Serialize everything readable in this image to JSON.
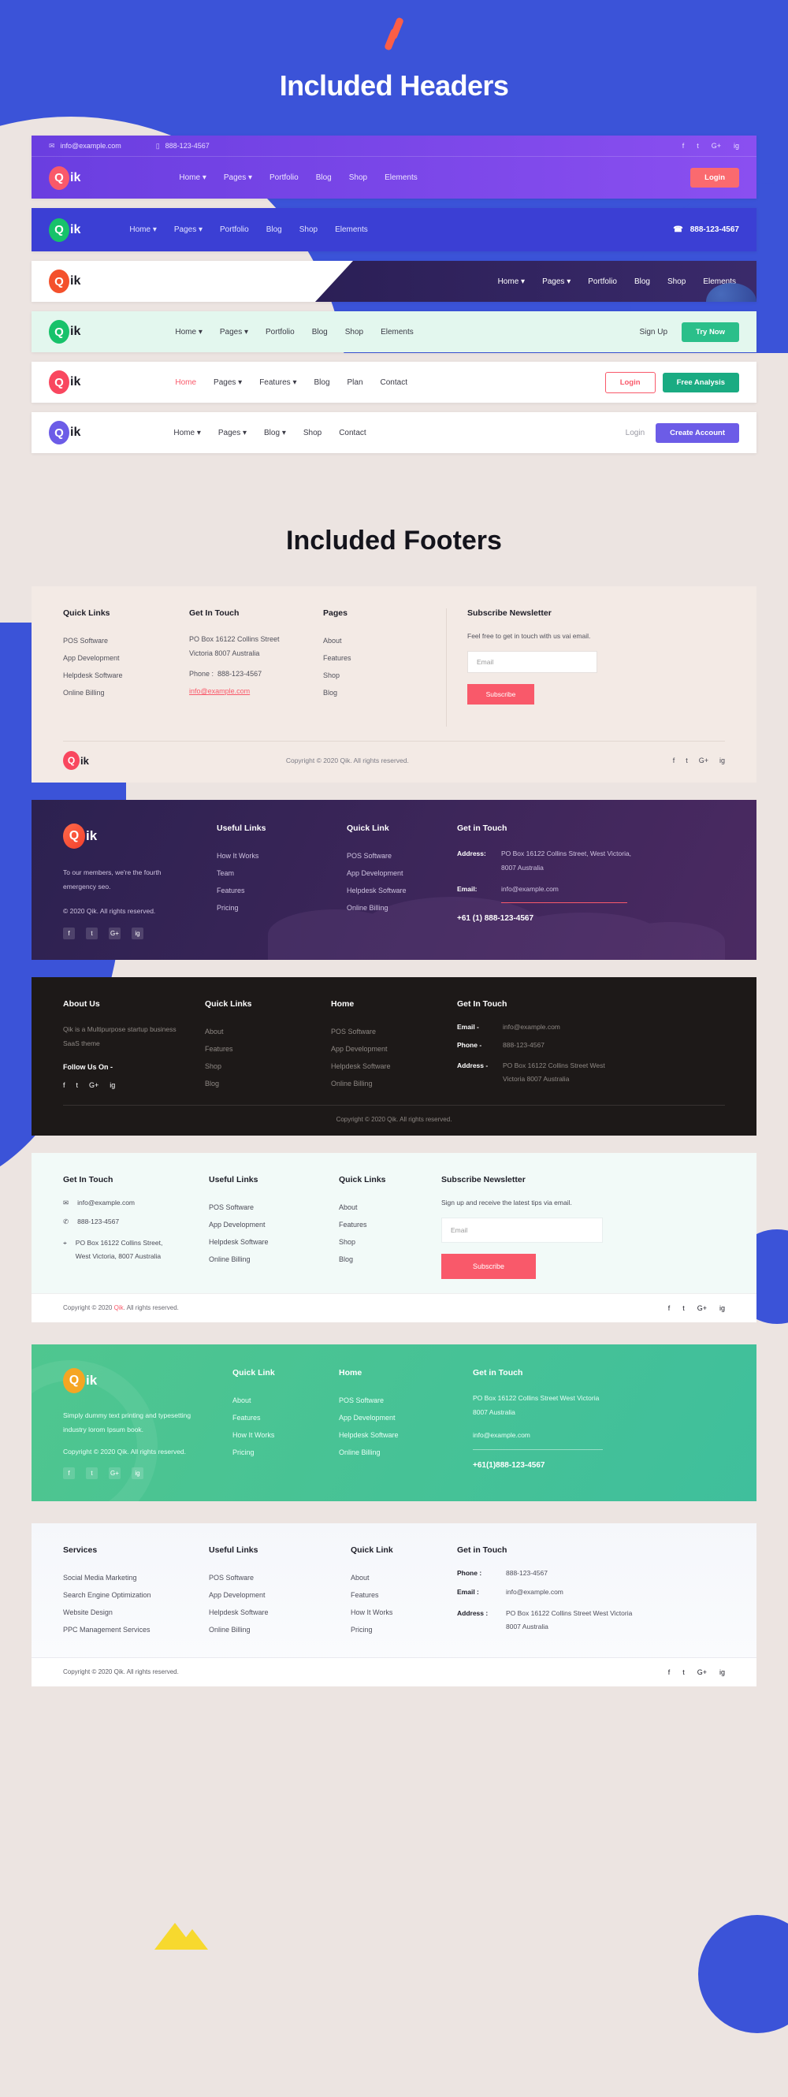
{
  "hero": {
    "logo_icon": "bolt-icon",
    "title": "Included Headers"
  },
  "footers_title": "Included Footers",
  "brand": {
    "mark": "Q",
    "name": "ik",
    "full": "Qik"
  },
  "social": {
    "facebook": "f",
    "twitter": "t",
    "google": "G+",
    "instagram": "ig"
  },
  "headers": [
    {
      "topbar": {
        "email_icon": "envelope-icon",
        "email": "info@example.com",
        "phone_icon": "mobile-icon",
        "phone": "888-123-4567"
      },
      "nav": [
        "Home",
        "Pages",
        "Portfolio",
        "Blog",
        "Shop",
        "Elements"
      ],
      "dropdowns": [
        "Home",
        "Pages"
      ],
      "cta": "Login"
    },
    {
      "nav": [
        "Home",
        "Pages",
        "Portfolio",
        "Blog",
        "Shop",
        "Elements"
      ],
      "phone_icon": "headset-icon",
      "phone": "888-123-4567"
    },
    {
      "nav": [
        "Home",
        "Pages",
        "Portfolio",
        "Blog",
        "Shop",
        "Elements"
      ]
    },
    {
      "nav": [
        "Home",
        "Pages",
        "Portfolio",
        "Blog",
        "Shop",
        "Elements"
      ],
      "signup": "Sign Up",
      "cta": "Try Now"
    },
    {
      "nav": [
        "Home",
        "Pages",
        "Features",
        "Blog",
        "Plan",
        "Contact"
      ],
      "active": "Home",
      "login": "Login",
      "cta": "Free Analysis"
    },
    {
      "nav": [
        "Home",
        "Pages",
        "Blog",
        "Shop",
        "Contact"
      ],
      "login": "Login",
      "cta": "Create Account"
    }
  ],
  "footer1": {
    "col1": {
      "title": "Quick Links",
      "items": [
        "POS Software",
        "App Development",
        "Helpdesk Software",
        "Online Billing"
      ]
    },
    "col2": {
      "title": "Get In Touch",
      "address": "PO Box 16122 Collins Street Victoria 8007 Australia",
      "phone_label": "Phone :",
      "phone": "888-123-4567",
      "email": "info@example.com"
    },
    "col3": {
      "title": "Pages",
      "items": [
        "About",
        "Features",
        "Shop",
        "Blog"
      ]
    },
    "col4": {
      "title": "Subscribe Newsletter",
      "note": "Feel free to get in touch with us vai email.",
      "placeholder": "Email",
      "button": "Subscribe"
    },
    "copyright": "Copyright © 2020 Qik. All rights reserved."
  },
  "footer2": {
    "tagline": "To our members, we're the fourth emergency seo.",
    "copyright": "© 2020 Qik. All rights reserved.",
    "col1": {
      "title": "Useful Links",
      "items": [
        "How It Works",
        "Team",
        "Features",
        "Pricing"
      ]
    },
    "col2": {
      "title": "Quick Link",
      "items": [
        "POS Software",
        "App Development",
        "Helpdesk Software",
        "Online Billing"
      ]
    },
    "col3": {
      "title": "Get in Touch",
      "address_label": "Address:",
      "address": "PO Box 16122 Collins Street, West Victoria, 8007 Australia",
      "email_label": "Email:",
      "email": "info@example.com",
      "phone": "+61 (1) 888-123-4567"
    }
  },
  "footer3": {
    "col1": {
      "title": "About Us",
      "desc": "Qik is a Multipurpose startup business SaaS theme",
      "follow": "Follow Us On -"
    },
    "col2": {
      "title": "Quick Links",
      "items": [
        "About",
        "Features",
        "Shop",
        "Blog"
      ]
    },
    "col3": {
      "title": "Home",
      "items": [
        "POS Software",
        "App Development",
        "Helpdesk Software",
        "Online Billing"
      ]
    },
    "col4": {
      "title": "Get In Touch",
      "email_label": "Email -",
      "email": "info@example.com",
      "phone_label": "Phone -",
      "phone": "888-123-4567",
      "address_label": "Address -",
      "address": "PO Box 16122 Collins Street West Victoria 8007 Australia"
    },
    "copyright": "Copyright © 2020 Qik. All rights reserved."
  },
  "footer4": {
    "col1": {
      "title": "Get In Touch",
      "email": "info@example.com",
      "phone": "888-123-4567",
      "address": "PO Box 16122 Collins Street, West Victoria, 8007 Australia"
    },
    "col2": {
      "title": "Useful Links",
      "items": [
        "POS Software",
        "App Development",
        "Helpdesk Software",
        "Online Billing"
      ]
    },
    "col3": {
      "title": "Quick Links",
      "items": [
        "About",
        "Features",
        "Shop",
        "Blog"
      ]
    },
    "col4": {
      "title": "Subscribe Newsletter",
      "note": "Sign up and receive the latest tips via email.",
      "placeholder": "Email",
      "button": "Subscribe"
    },
    "copyright_pre": "Copyright © 2020 ",
    "copyright_brand": "Qik",
    "copyright_post": ". All rights reserved."
  },
  "footer5": {
    "tagline": "Simply dummy text printing and typesetting industry lorom Ipsum book.",
    "copyright": "Copyright © 2020 Qik. All rights reserved.",
    "col1": {
      "title": "Quick Link",
      "items": [
        "About",
        "Features",
        "How It Works",
        "Pricing"
      ]
    },
    "col2": {
      "title": "Home",
      "items": [
        "POS Software",
        "App Development",
        "Helpdesk Software",
        "Online Billing"
      ]
    },
    "col3": {
      "title": "Get in Touch",
      "address": "PO Box 16122 Collins Street West Victoria 8007 Australia",
      "email": "info@example.com",
      "phone": "+61(1)888-123-4567"
    }
  },
  "footer6": {
    "col1": {
      "title": "Services",
      "items": [
        "Social Media Marketing",
        "Search Engine Optimization",
        "Website Design",
        "PPC Management Services"
      ]
    },
    "col2": {
      "title": "Useful Links",
      "items": [
        "POS Software",
        "App Development",
        "Helpdesk Software",
        "Online Billing"
      ]
    },
    "col3": {
      "title": "Quick Link",
      "items": [
        "About",
        "Features",
        "How It Works",
        "Pricing"
      ]
    },
    "col4": {
      "title": "Get in Touch",
      "phone_label": "Phone :",
      "phone": "888-123-4567",
      "email_label": "Email :",
      "email": "info@example.com",
      "address_label": "Address :",
      "address": "PO Box 16122 Collins Street West Victoria 8007 Australia"
    },
    "copyright": "Copyright © 2020 Qik. All rights reserved."
  },
  "colors": {
    "hero_blue": "#3b53d8",
    "page_bg": "#ece4e1",
    "orange": "#fc5e46",
    "red": "#f9596a",
    "green": "#2bbf8a",
    "purple": "#6a3ee0",
    "violet": "#6c5ce7"
  }
}
